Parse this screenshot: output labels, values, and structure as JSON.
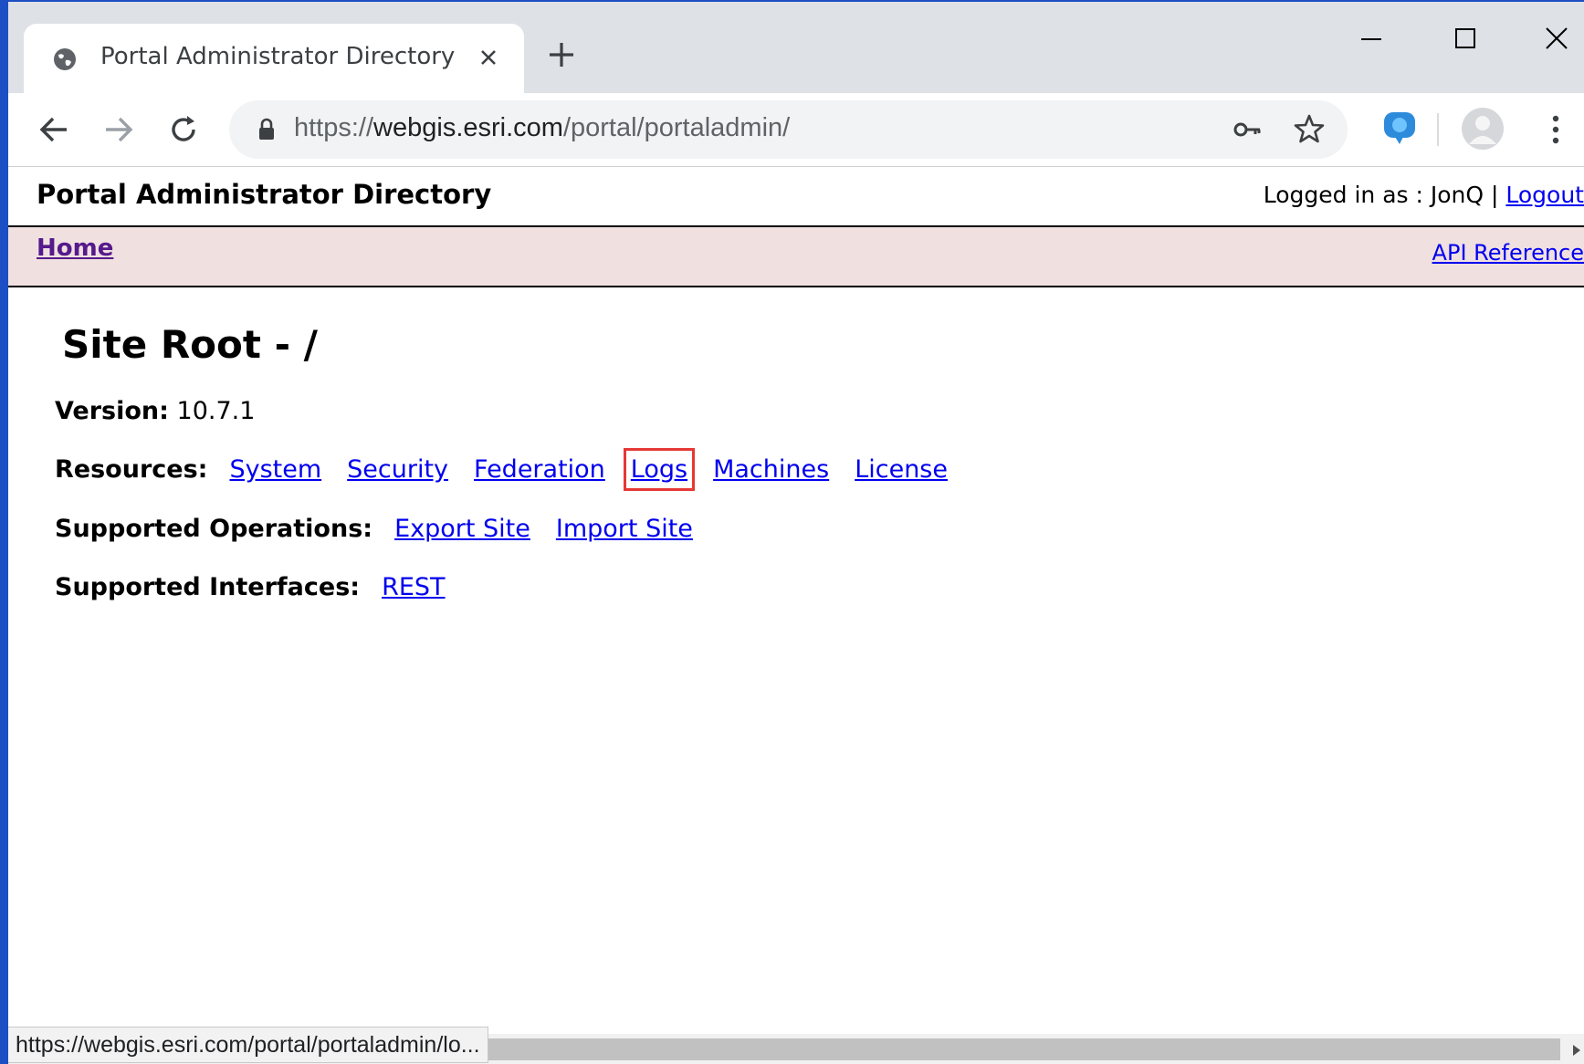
{
  "browser": {
    "tab_title": "Portal Administrator Directory",
    "url_scheme": "https://",
    "url_host": "webgis.esri.com",
    "url_path": "/portal/portaladmin/",
    "status_url": "https://webgis.esri.com/portal/portaladmin/lo..."
  },
  "page": {
    "header_title": "Portal Administrator Directory",
    "logged_in_prefix": "Logged in as : JonQ | ",
    "logout_label": "Logout",
    "home_label": "Home",
    "api_reference_label": "API Reference",
    "heading": "Site Root - /",
    "version_label": "Version:",
    "version_value": "10.7.1",
    "resources_label": "Resources:",
    "resources": [
      "System",
      "Security",
      "Federation",
      "Logs",
      "Machines",
      "License"
    ],
    "operations_label": "Supported Operations:",
    "operations": [
      "Export Site",
      "Import Site"
    ],
    "interfaces_label": "Supported Interfaces:",
    "interfaces": [
      "REST"
    ],
    "highlighted_link": "Logs"
  },
  "colors": {
    "link": "#0000ee",
    "visited_link": "#551a8b",
    "nav_bar": "#f0e0e0",
    "highlight_box": "#e53935",
    "desktop": "#1d4fc4"
  },
  "icons": {
    "favicon": "globe-icon",
    "lock": "lock-icon",
    "key": "key-icon",
    "star": "star-icon",
    "extension": "walkme-extension-icon",
    "profile": "avatar-icon"
  }
}
